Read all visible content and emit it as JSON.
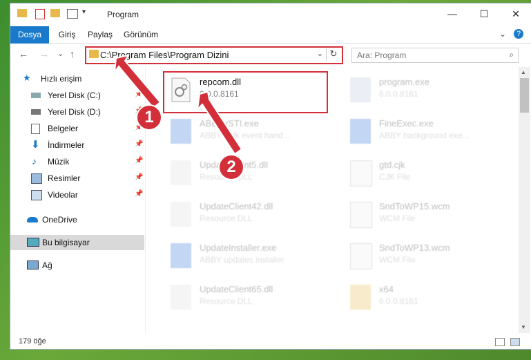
{
  "titlebar": {
    "title": "Program",
    "minimize": "—",
    "maximize": "☐",
    "close": "✕"
  },
  "ribbon": {
    "tabs": [
      {
        "label": "Dosya",
        "active": true
      },
      {
        "label": "Giriş"
      },
      {
        "label": "Paylaş"
      },
      {
        "label": "Görünüm"
      }
    ],
    "expand": "⌄",
    "help": "?"
  },
  "address": {
    "back": "←",
    "forward": "→",
    "recent": "⌄",
    "up": "↑",
    "path": "C:\\Program Files\\Program Dizini",
    "dropdown": "⌄",
    "refresh": "↻"
  },
  "search": {
    "placeholder": "Ara: Program",
    "icon": "search-icon"
  },
  "sidebar": {
    "items": [
      {
        "label": "Hızlı erişim",
        "icon": "star-icon"
      },
      {
        "label": "Yerel Disk (C:)",
        "icon": "drive-icon",
        "pinned": true
      },
      {
        "label": "Yerel Disk (D:)",
        "icon": "drive-icon",
        "pinned": true
      },
      {
        "label": "Belgeler",
        "icon": "documents-icon",
        "pinned": true
      },
      {
        "label": "İndirmeler",
        "icon": "download-icon",
        "pinned": true
      },
      {
        "label": "Müzik",
        "icon": "music-icon",
        "pinned": true
      },
      {
        "label": "Resimler",
        "icon": "pictures-icon",
        "pinned": true
      },
      {
        "label": "Videolar",
        "icon": "videos-icon",
        "pinned": true
      },
      {
        "label": "OneDrive",
        "icon": "cloud-icon"
      },
      {
        "label": "Bu bilgisayar",
        "icon": "computer-icon",
        "selected": true
      },
      {
        "label": "Ağ",
        "icon": "network-icon"
      }
    ]
  },
  "files": [
    {
      "name": "repcom.dll",
      "desc": "6.0.0.8161",
      "icon": "dll-icon",
      "highlighted": true
    },
    {
      "name": "program.exe",
      "desc": "6.0.0.8161",
      "icon": "exe-icon"
    },
    {
      "name": "ABBYySTI.exe",
      "desc": "ABBYY clk event hand...",
      "icon": "exe-icon"
    },
    {
      "name": "FineExec.exe",
      "desc": "ABBY background exe...",
      "icon": "exe-icon"
    },
    {
      "name": "UpdateClient5.dll",
      "desc": "Resource DLL",
      "icon": "dll-icon"
    },
    {
      "name": "gtd.cjk",
      "desc": "CJK File",
      "icon": "file-icon"
    },
    {
      "name": "UpdateClient42.dll",
      "desc": "Resource DLL",
      "icon": "dll-icon"
    },
    {
      "name": "SndToWP15.wcm",
      "desc": "WCM File",
      "icon": "file-icon"
    },
    {
      "name": "UpdateInstaller.exe",
      "desc": "ABBY updates installer",
      "icon": "exe-icon"
    },
    {
      "name": "SndToWP13.wcm",
      "desc": "WCM File",
      "icon": "file-icon"
    },
    {
      "name": "UpdateClient65.dll",
      "desc": "Resource DLL",
      "icon": "dll-icon"
    },
    {
      "name": "x64",
      "desc": "6.0.0.8161",
      "icon": "zip-folder-icon"
    }
  ],
  "status": {
    "count": "179 öğe"
  },
  "annotations": {
    "step1": "1",
    "step2": "2",
    "accent": "#d32f3a"
  }
}
